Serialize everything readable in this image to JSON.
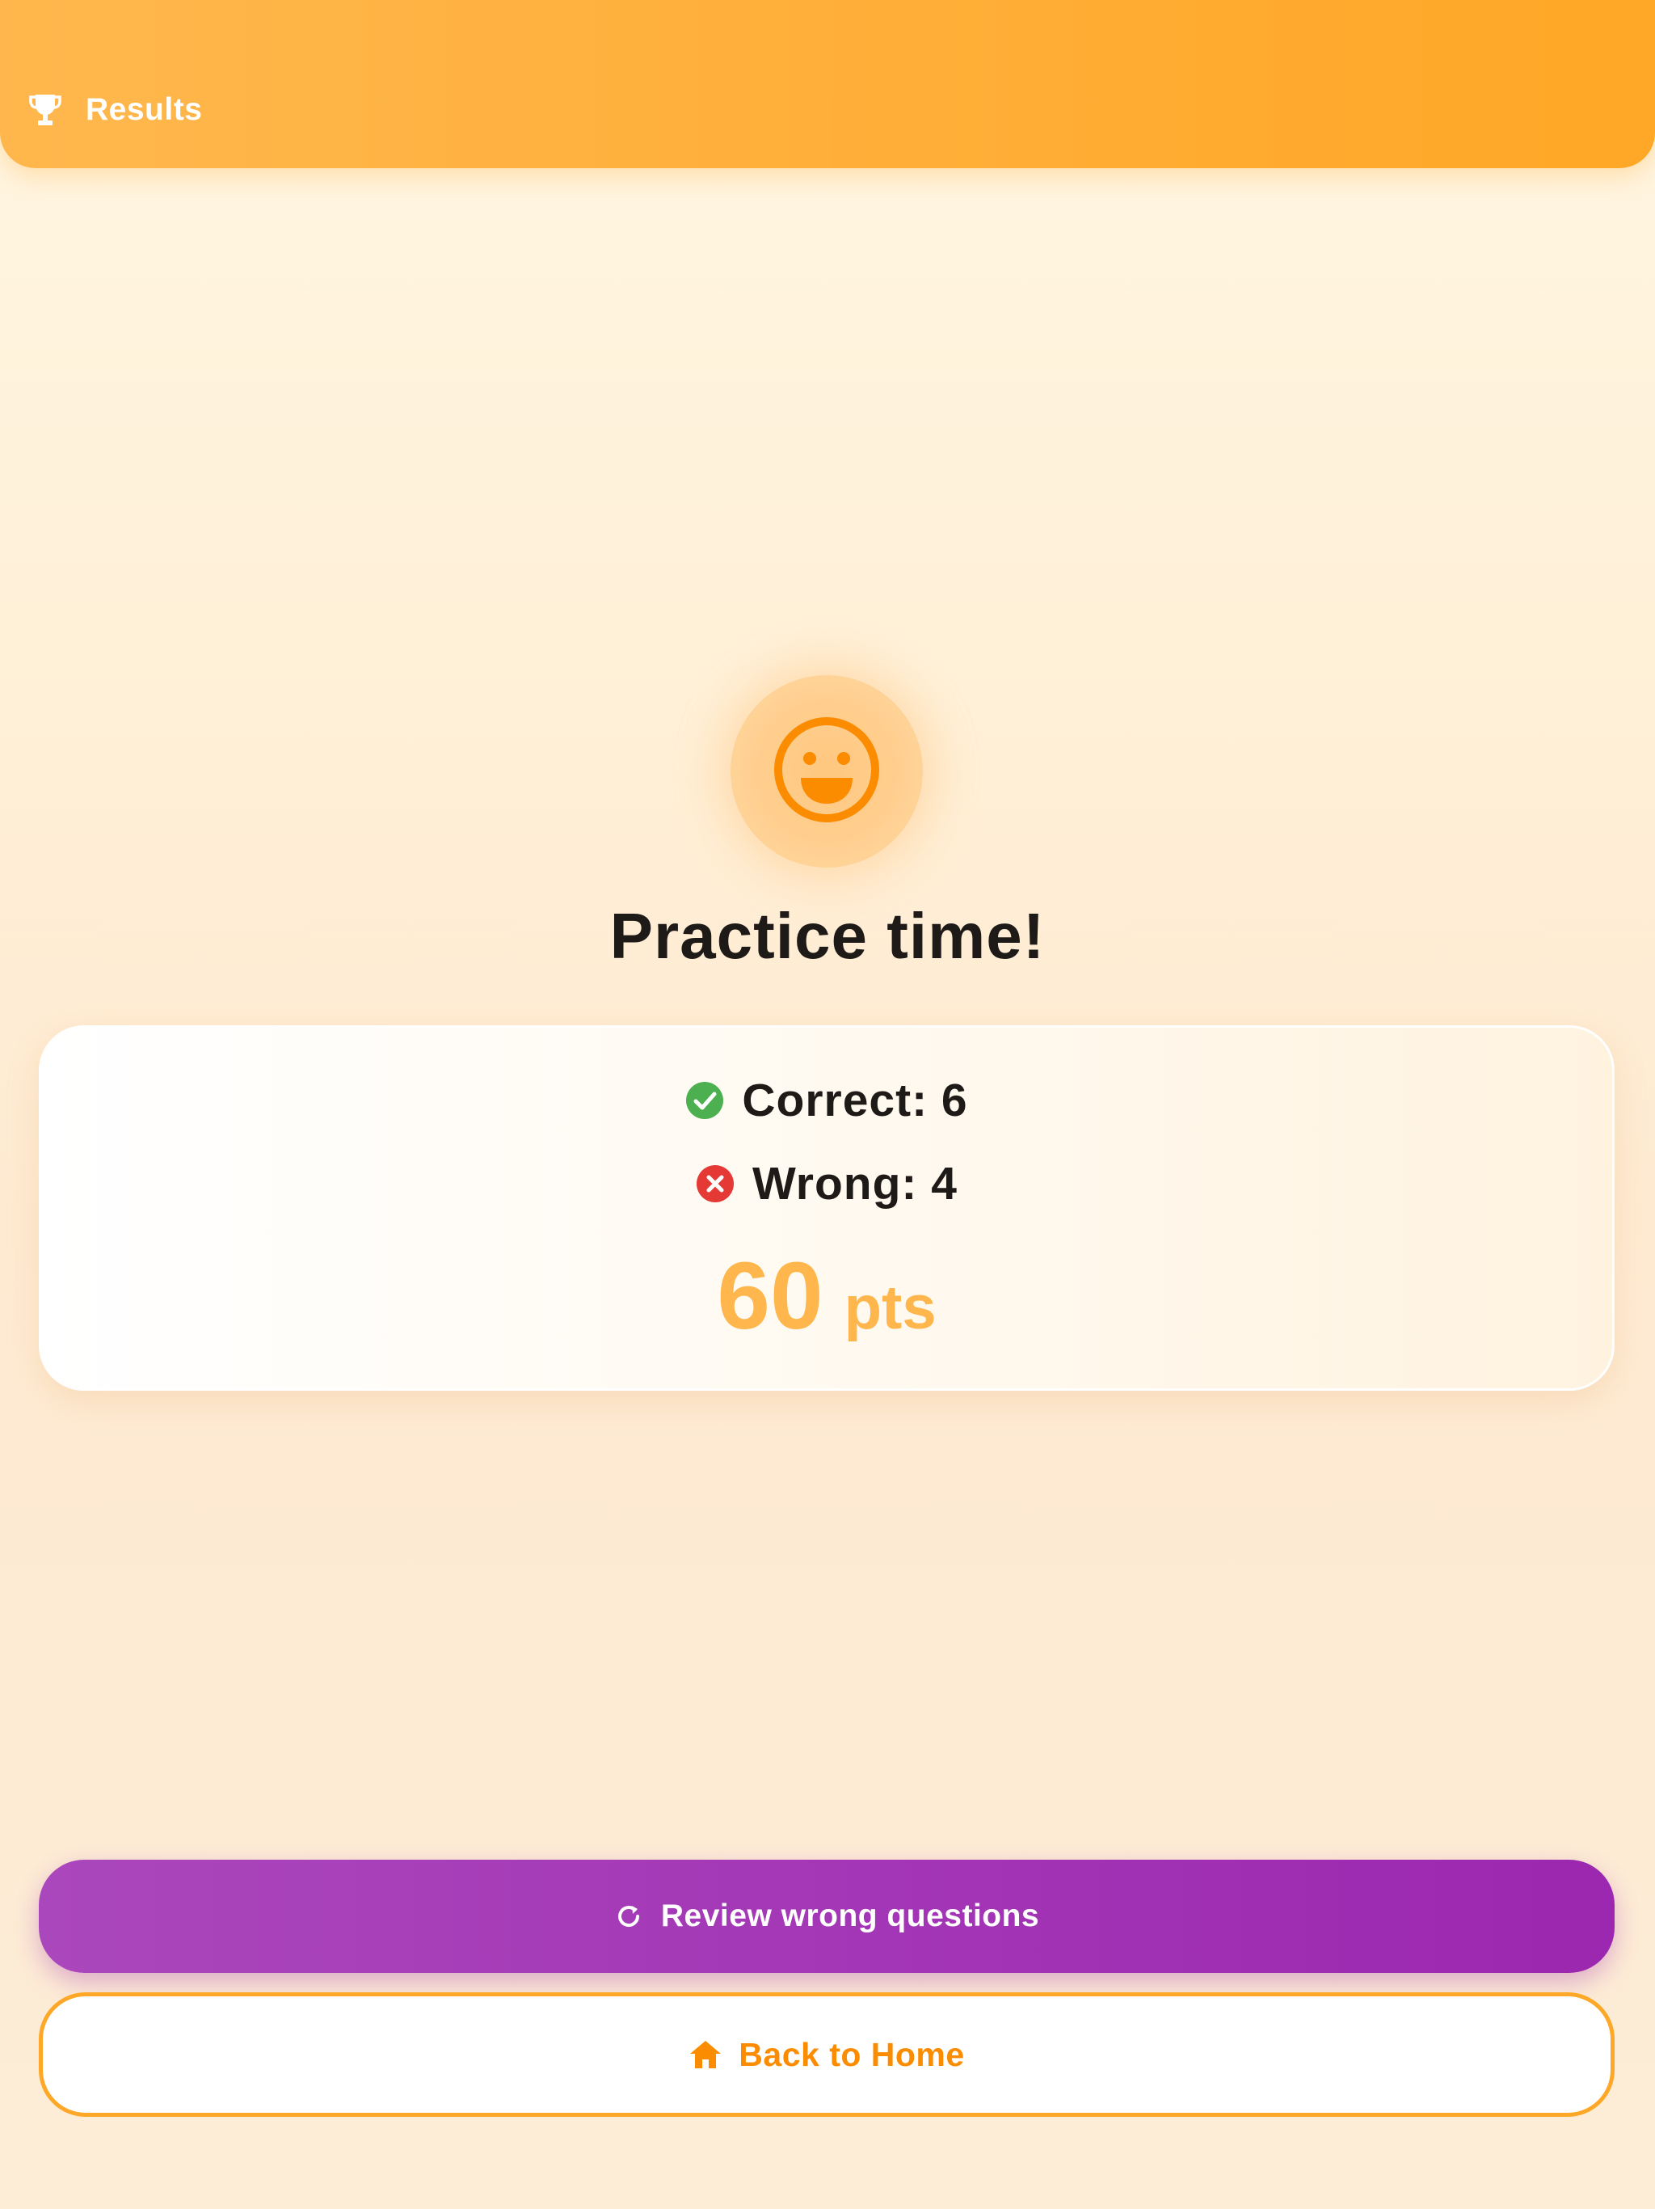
{
  "header": {
    "title": "Results",
    "icon": "trophy-icon"
  },
  "result": {
    "emoji_icon": "smiley-face-icon",
    "headline": "Practice time!"
  },
  "stats": {
    "correct_label": "Correct: 6",
    "correct_icon": "check-circle-icon",
    "wrong_label": "Wrong: 4",
    "wrong_icon": "x-circle-icon",
    "score_value": "60",
    "score_unit": "pts"
  },
  "actions": {
    "review_label": "Review wrong questions",
    "review_icon": "refresh-icon",
    "home_label": "Back to Home",
    "home_icon": "home-icon"
  },
  "colors": {
    "header_gradient_start": "#ffb74d",
    "header_gradient_end": "#ffa726",
    "correct_green": "#4caf50",
    "wrong_red": "#e53935",
    "score_orange": "#ffb74d",
    "emoji_orange": "#fb8c00",
    "review_purple": "#9c27b0",
    "home_orange": "#fb8c00"
  }
}
